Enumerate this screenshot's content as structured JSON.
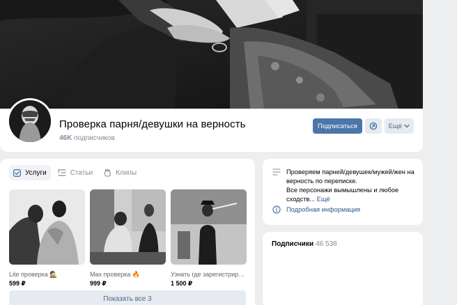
{
  "group": {
    "title": "Проверка парня/девушки на верность",
    "subscribers_count": "46K",
    "subscribers_label": "подписчиков"
  },
  "actions": {
    "subscribe_label": "Подписаться",
    "more_label": "Ещё",
    "round_icon": "clock-arrow-icon"
  },
  "tabs": [
    {
      "label": "Услуги",
      "icon": "services-icon",
      "active": true
    },
    {
      "label": "Статьи",
      "icon": "articles-icon",
      "active": false
    },
    {
      "label": "Клипы",
      "icon": "clips-icon",
      "active": false
    }
  ],
  "products": [
    {
      "name": "Lite проверка 🕵",
      "price": "599 ₽"
    },
    {
      "name": "Max проверка 🔥",
      "price": "999 ₽"
    },
    {
      "name": "Узнать где зарегистриро...",
      "price": "1 500 ₽"
    }
  ],
  "show_all_label": "Показать все 3",
  "info": {
    "description": "Проверяем парней/девушек/мужей/жен на верность по переписке.\nВсе персонажи вымышлены и любое сходств...",
    "more_label": "Ещё",
    "details_link": "Подробная информация"
  },
  "subscribers_block": {
    "title": "Подписчики",
    "count": "46 538"
  },
  "colors": {
    "accent": "#4a76a8",
    "link": "#2a5885",
    "secondary_button": "#e5ebf1",
    "background": "#edeef0"
  }
}
